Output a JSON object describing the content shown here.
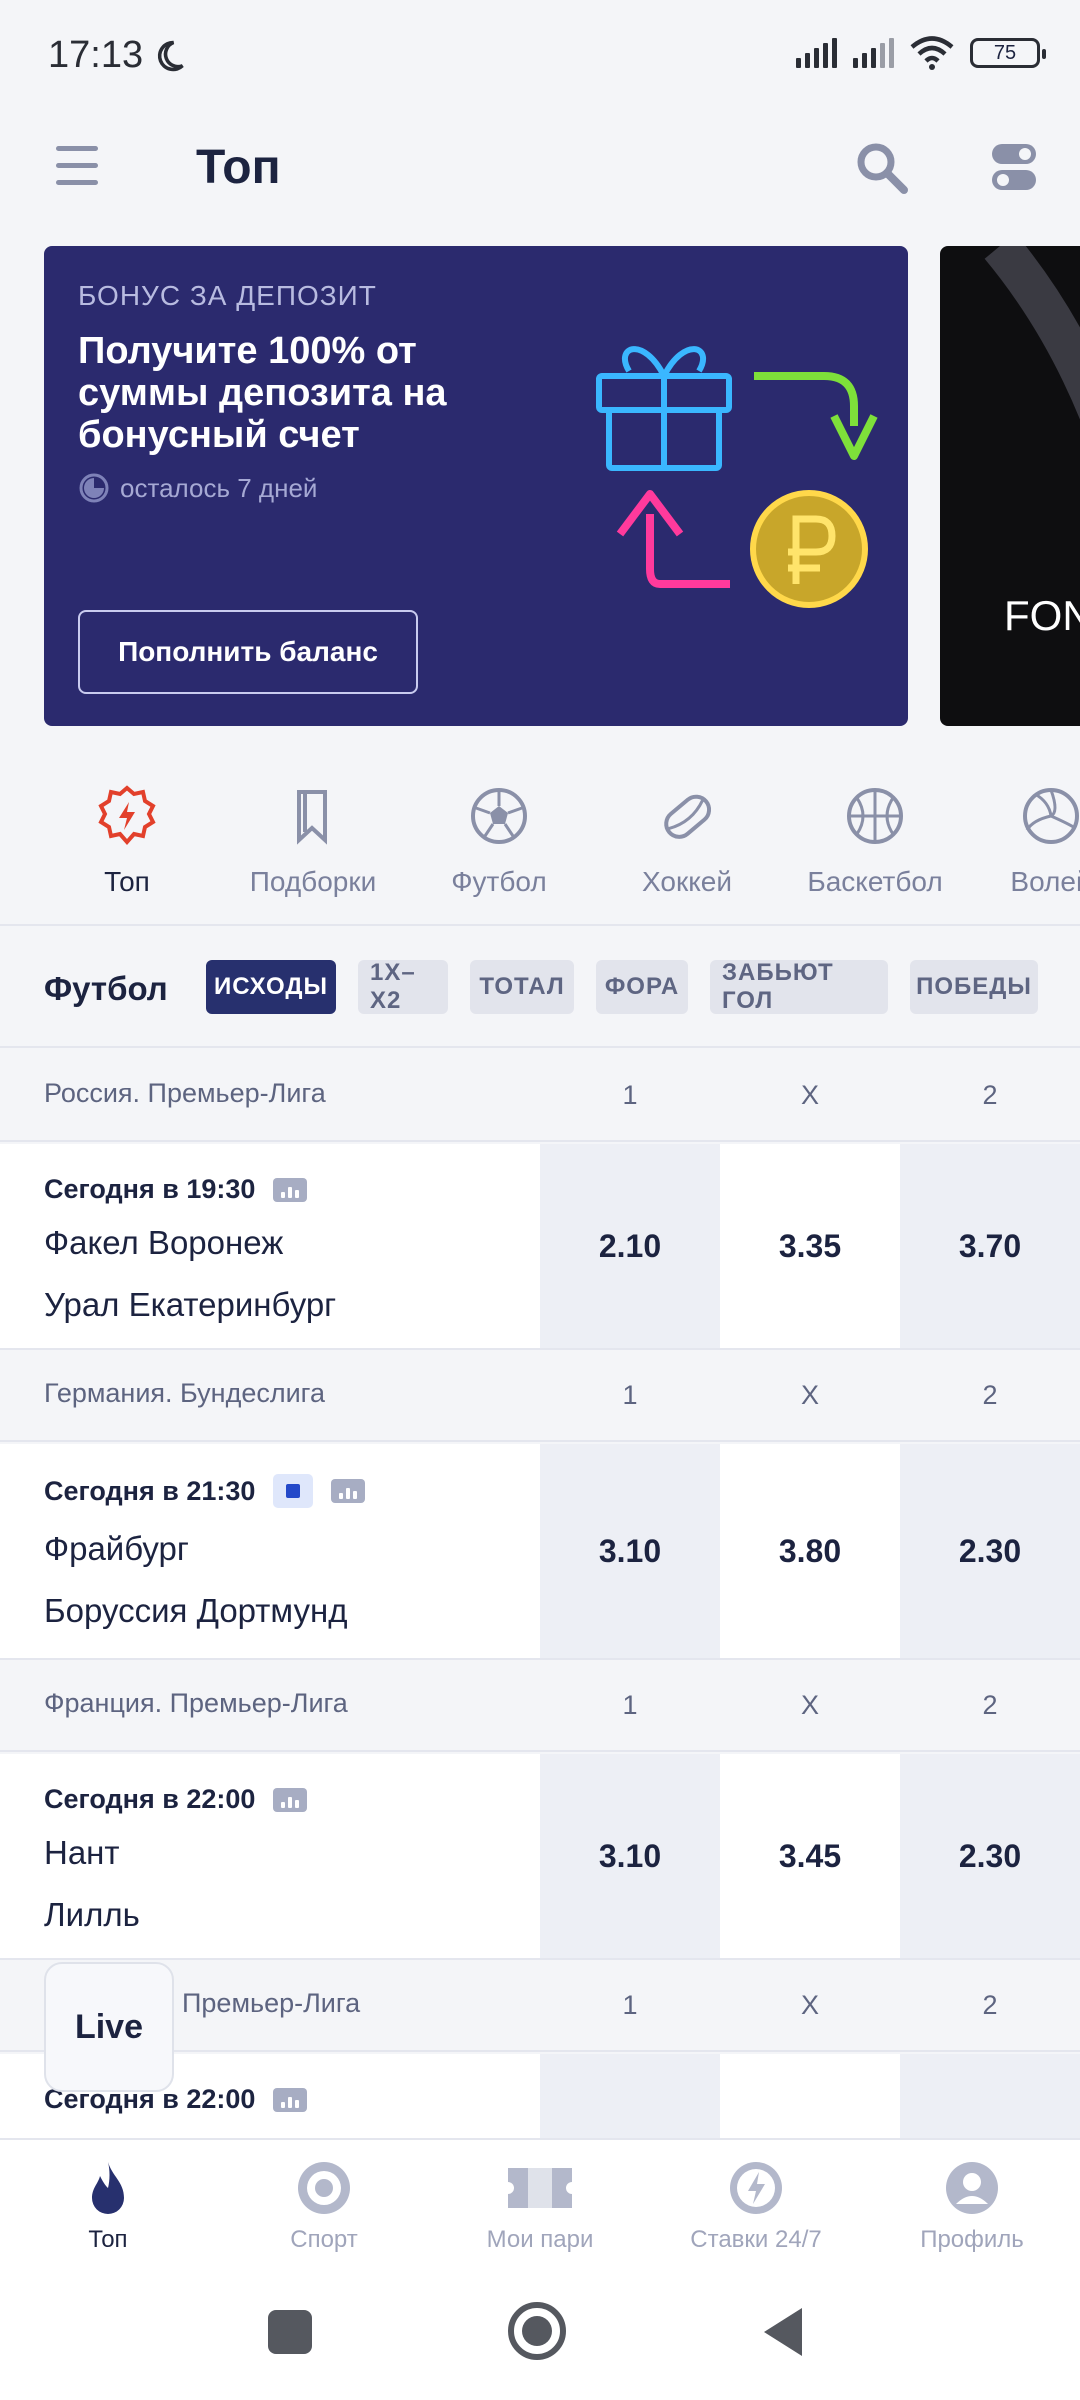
{
  "status_bar": {
    "time": "17:13",
    "battery": "75"
  },
  "header": {
    "title": "Топ"
  },
  "banner": {
    "kicker": "БОНУС ЗА ДЕПОЗИТ",
    "headline": "Получите 100% от суммы депозита на бонусный счет",
    "days_left": "осталось 7 дней",
    "cta": "Пополнить баланс",
    "colors": {
      "background": "#2b2a6e"
    }
  },
  "banner2": {
    "text": "FON"
  },
  "sports": [
    {
      "label": "Топ",
      "icon": "top-badge-icon",
      "active": true
    },
    {
      "label": "Подборки",
      "icon": "bookmark-icon",
      "active": false
    },
    {
      "label": "Футбол",
      "icon": "soccer-ball-icon",
      "active": false
    },
    {
      "label": "Хоккей",
      "icon": "hockey-puck-icon",
      "active": false
    },
    {
      "label": "Баскетбол",
      "icon": "basketball-icon",
      "active": false
    },
    {
      "label": "Волей",
      "icon": "volleyball-icon",
      "active": false
    }
  ],
  "markets": {
    "caption": "Футбол",
    "chips": [
      "ИСХОДЫ",
      "1Х–Х2",
      "ТОТАЛ",
      "ФОРА",
      "ЗАБЬЮТ ГОЛ",
      "ПОБЕДЫ"
    ],
    "selected": "ИСХОДЫ"
  },
  "odds_headers": [
    "1",
    "X",
    "2"
  ],
  "leagues": [
    {
      "name": "Россия. Премьер-Лига",
      "match": {
        "when": "Сегодня в 19:30",
        "team1": "Факел Воронеж",
        "team2": "Урал Екатеринбург",
        "odds": [
          "2.10",
          "3.35",
          "3.70"
        ],
        "live": false
      }
    },
    {
      "name": "Германия. Бундеслига",
      "match": {
        "when": "Сегодня в 21:30",
        "team1": "Фрайбург",
        "team2": "Боруссия Дортмунд",
        "odds": [
          "3.10",
          "3.80",
          "2.30"
        ],
        "live": true
      }
    },
    {
      "name": "Франция. Премьер-Лига",
      "match": {
        "when": "Сегодня в 22:00",
        "team1": "Нант",
        "team2": "Лилль",
        "odds": [
          "3.10",
          "3.45",
          "2.30"
        ],
        "live": false
      }
    },
    {
      "name": "Премьер-Лига",
      "match": {
        "when": "Сегодня в 22:00"
      }
    }
  ],
  "live_button": "Live",
  "bottom_nav": [
    {
      "label": "Топ",
      "icon": "flame-icon",
      "active": true
    },
    {
      "label": "Спорт",
      "icon": "target-icon",
      "active": false
    },
    {
      "label": "Мои пари",
      "icon": "ticket-icon",
      "active": false
    },
    {
      "label": "Ставки 24/7",
      "icon": "lightning-icon",
      "active": false
    },
    {
      "label": "Профиль",
      "icon": "profile-icon",
      "active": false
    }
  ],
  "colors": {
    "accent": "#27306e",
    "active_red": "#e2402b"
  }
}
